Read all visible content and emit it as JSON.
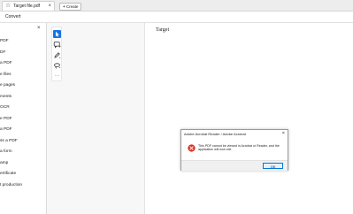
{
  "tabbar": {
    "tab_title": "Target file.pdf",
    "tab_icon": "star-icon",
    "close_glyph": "×",
    "create_label": "Create",
    "create_glyph": "+"
  },
  "menubar": {
    "convert_label": "Convert"
  },
  "left_panel": {
    "close_glyph": "×",
    "items": [
      "PDF",
      "DF",
      "a PDF",
      "e files",
      "e pages",
      "ments",
      "OCR",
      "e PDF",
      "a PDF",
      "ss a PDF",
      "a form",
      "amp",
      "ertificate",
      "t production"
    ]
  },
  "toolbar": {
    "items": [
      {
        "name": "select-tool-icon",
        "active": true
      },
      {
        "name": "add-comment-icon",
        "active": false
      },
      {
        "name": "draw-pen-icon",
        "active": false
      },
      {
        "name": "lasso-icon",
        "active": false
      },
      {
        "name": "more-tools-icon",
        "active": false
      }
    ],
    "more_glyph": "···"
  },
  "document": {
    "text": "Target"
  },
  "dialog": {
    "title": "Adobe Acrobat Reader / Adobe Acrobat",
    "close_glyph": "×",
    "message": "This PDF cannot be viewed in Acrobat or Reader, and the application will now exit",
    "ok_label": "OK",
    "error_color": "#d93025"
  }
}
